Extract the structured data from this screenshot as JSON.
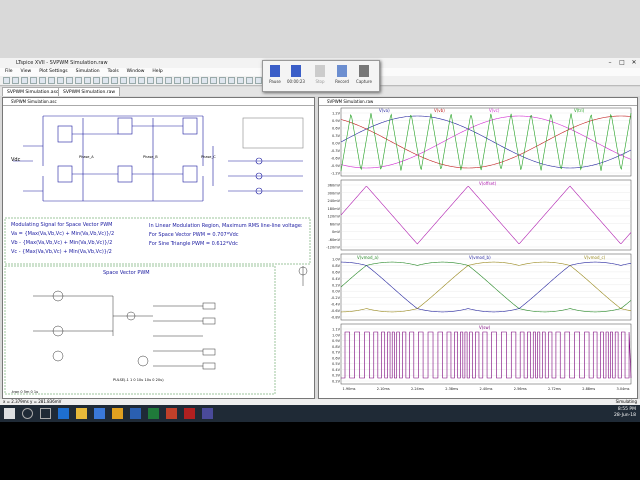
{
  "app": {
    "title": "LTspice XVII - SVPWM Simulation.raw",
    "window_controls": [
      "–",
      "□",
      "✕"
    ]
  },
  "menu": [
    "File",
    "View",
    "Plot Settings",
    "Simulation",
    "Tools",
    "Window",
    "Help"
  ],
  "tabs": [
    "SVPWM Simulation.asc",
    "SVPWM Simulation.raw"
  ],
  "sim_panel": {
    "pause": "Pause",
    "time": "00:00:23",
    "stop": "Stop",
    "record": "Record",
    "capture": "Capture"
  },
  "schematic": {
    "title": "SVPWM Simulation.asc",
    "heading": "Modulating Signal for Space Vector PWM",
    "eq1": "Va = {Max(Va,Vb,Vc) + Min(Va,Vb,Vc)}/2",
    "eq2": "Vb - {Max(Va,Vb,Vc) + Min(Va,Vb,Vc)}/2",
    "eq3": "Vc - {Max(Va,Vb,Vc) + Min(Va,Vb,Vc)}/2",
    "note1": "In Linear Modulation Region, Maximum RMS line-line voltage:",
    "note2": "For Space Vector PWM = 0.707*Vdc",
    "note3": "For Sine Triangle PWM = 0.612*Vdc",
    "svpwm_label": "Space Vector PWM",
    "vdc": "Vdc",
    "phase_a": "Phase_A",
    "phase_b": "Phase_B",
    "phase_c": "Phase_C",
    "sim_cmd": ".tran 0 5m 0 1u",
    "pulse": "PULSE(-1 1 0 10u 10u 0 20u)"
  },
  "waveform": {
    "title": "SVPWM Simulation.raw",
    "pane1_traces": [
      "V(va)",
      "V(vb)",
      "V(vc)",
      "V(tri)"
    ],
    "pane1_colors": [
      "#2a2aa0",
      "#c02020",
      "#d030d0",
      "#20a020"
    ],
    "pane1_ticks": [
      "1.2V",
      "0.9V",
      "0.6V",
      "0.3V",
      "0.0V",
      "-0.3V",
      "-0.6V",
      "-0.9V",
      "-1.2V"
    ],
    "pane2_trace": "V(offset)",
    "pane2_color": "#b020b0",
    "pane2_ticks": [
      "360mV",
      "300mV",
      "240mV",
      "180mV",
      "120mV",
      "60mV",
      "0mV",
      "-60mV",
      "-120mV"
    ],
    "pane3_traces": [
      "V(vmod_a)",
      "V(vmod_b)",
      "V(vmod_c)"
    ],
    "pane3_colors": [
      "#2a8a2a",
      "#2a2aa0",
      "#9a8a20"
    ],
    "pane3_ticks": [
      "1.0V",
      "0.8V",
      "0.6V",
      "0.4V",
      "0.2V",
      "0.0V",
      "-0.2V",
      "-0.4V",
      "-0.6V",
      "-0.8V"
    ],
    "pane4_trace": "V(sw)",
    "pane4_color": "#7a007a",
    "pane4_ticks": [
      "1.1V",
      "1.0V",
      "0.9V",
      "0.8V",
      "0.7V",
      "0.6V",
      "0.5V",
      "0.4V",
      "0.3V",
      "0.2V"
    ],
    "x_ticks": [
      "1.90ms",
      "2.10ms",
      "2.24ms",
      "2.38ms",
      "2.40ms",
      "2.56ms",
      "2.72ms",
      "2.88ms",
      "3.04ms"
    ]
  },
  "status": {
    "left": "x = 2.379ms   y = 281.836mV",
    "right": "Simulating"
  },
  "tray": {
    "time": "8:55 PM",
    "date": "28-Jun-18"
  }
}
